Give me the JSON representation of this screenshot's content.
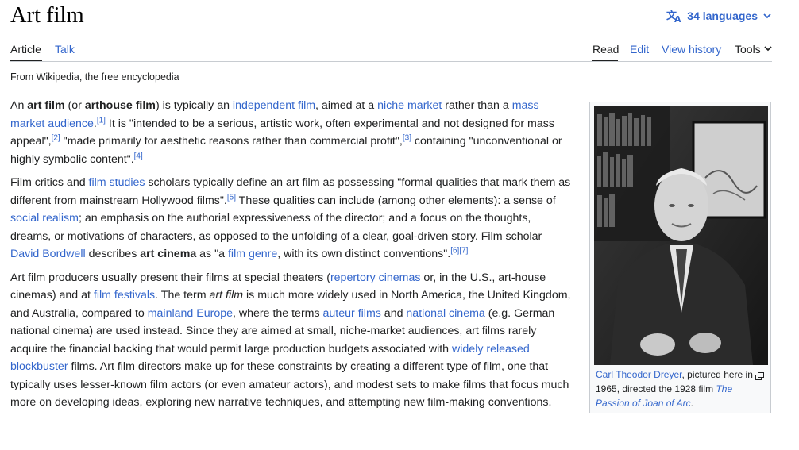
{
  "page": {
    "title": "Art film",
    "languages_label": "34 languages",
    "tagline": "From Wikipedia, the free encyclopedia"
  },
  "tabs": {
    "article": "Article",
    "talk": "Talk",
    "read": "Read",
    "edit": "Edit",
    "view_history": "View history",
    "tools": "Tools"
  },
  "para1": {
    "t1": "An ",
    "b1": "art film",
    "t2": " (or ",
    "b2": "arthouse film",
    "t3": ") is typically an ",
    "l1": "independent film",
    "t4": ", aimed at a ",
    "l2": "niche market",
    "t5": " rather than a ",
    "l3": "mass market audience",
    "t6": ".",
    "r1": "[1]",
    "t7": " It is \"intended to be a serious, artistic work, often experimental and not designed for mass appeal\",",
    "r2": "[2]",
    "t8": " \"made primarily for aesthetic reasons rather than commercial profit\",",
    "r3": "[3]",
    "t9": " containing \"unconventional or highly symbolic content\".",
    "r4": "[4]"
  },
  "para2": {
    "t1": "Film critics and ",
    "l1": "film studies",
    "t2": " scholars typically define an art film as possessing \"formal qualities that mark them as different from mainstream Hollywood films\".",
    "r1": "[5]",
    "t3": " These qualities can include (among other elements): a sense of ",
    "l2": "social realism",
    "t4": "; an emphasis on the authorial expressiveness of the director; and a focus on the thoughts, dreams, or motivations of characters, as opposed to the unfolding of a clear, goal-driven story. Film scholar ",
    "l3": "David Bordwell",
    "t5": " describes ",
    "b1": "art cinema",
    "t6": " as \"a ",
    "l4": "film genre",
    "t7": ", with its own distinct conventions\".",
    "r2": "[6]",
    "r3": "[7]"
  },
  "para3": {
    "t1": "Art film producers usually present their films at special theaters (",
    "l1": "repertory cinemas",
    "t2": " or, in the U.S., art-house cinemas) and at ",
    "l2": "film festivals",
    "t3": ". The term ",
    "i1": "art film",
    "t4": " is much more widely used in North America, the United Kingdom, and Australia, compared to ",
    "l3": "mainland Europe",
    "t5": ", where the terms ",
    "l4": "auteur films",
    "t6": " and ",
    "l5": "national cinema",
    "t7": " (e.g. German national cinema) are used instead. Since they are aimed at small, niche-market audiences, art films rarely acquire the financial backing that would permit large production budgets associated with ",
    "l6": "widely released blockbuster",
    "t8": " films. Art film directors make up for these constraints by creating a different type of film, one that typically uses lesser-known film actors (or even amateur actors), and modest sets to make films that focus much more on developing ideas, exploring new narrative techniques, and attempting new film-making conventions."
  },
  "infobox": {
    "caption_link": "Carl Theodor Dreyer",
    "caption_text": ", pictured here in 1965, directed the 1928 film ",
    "caption_film": "The Passion of Joan of Arc",
    "caption_end": "."
  },
  "colors": {
    "link": "#3366cc",
    "text": "#202122",
    "border": "#a2a9b1"
  },
  "icons": [
    "translate-icon",
    "chevron-down-icon",
    "magnify-icon"
  ]
}
